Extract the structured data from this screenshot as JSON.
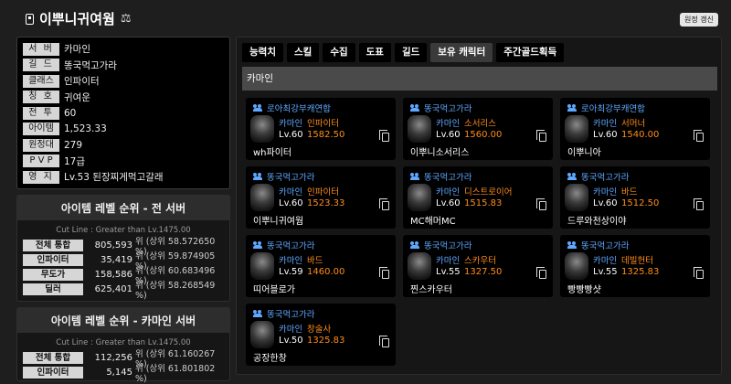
{
  "header": {
    "title": "이뿌니귀여웜",
    "refresh_label": "원정 갱신"
  },
  "profile": [
    {
      "label": "서 버",
      "value": "카마인"
    },
    {
      "label": "길 드",
      "value": "똥국먹고가라"
    },
    {
      "label": "클래스",
      "value": "인파이터"
    },
    {
      "label": "칭 호",
      "value": "귀여운"
    },
    {
      "label": "전 투",
      "value": "60"
    },
    {
      "label": "아이템",
      "value": "1,523.33"
    },
    {
      "label": "원정대",
      "value": "279"
    },
    {
      "label": "P V P",
      "value": "17급"
    },
    {
      "label": "영 지",
      "value": "Lv.53 된장찌게먹고갈래"
    }
  ],
  "rank_all": {
    "title": "아이템 레벨 순위 - 전 서버",
    "cutline": "Cut Line : Greater than Lv.1475.00",
    "rows": [
      {
        "label": "전체 통합",
        "rank": "805,593",
        "unit": "위 (상위 58.572650 %)"
      },
      {
        "label": "인파이터",
        "rank": "35,419",
        "unit": "위 (상위 59.874905 %)"
      },
      {
        "label": "무도가",
        "rank": "158,586",
        "unit": "위 (상위 60.683496 %)"
      },
      {
        "label": "딜러",
        "rank": "625,401",
        "unit": "위 (상위 58.268549 %)"
      }
    ]
  },
  "rank_server": {
    "title": "아이템 레벨 순위 - 카마인 서버",
    "cutline": "Cut Line : Greater than Lv.1475.00",
    "rows": [
      {
        "label": "전체 통합",
        "rank": "112,256",
        "unit": "위 (상위 61.160267 %)"
      },
      {
        "label": "인파이터",
        "rank": "5,145",
        "unit": "위 (상위 61.801802 %)"
      }
    ]
  },
  "tabs": [
    "능력치",
    "스킬",
    "수집",
    "도표",
    "길드",
    "보유 캐릭터",
    "주간골드획득"
  ],
  "active_tab": "보유 캐릭터",
  "server_name": "카마인",
  "characters": [
    {
      "guild": "로아최강부캐연합",
      "server": "카마인",
      "class": "인파이터",
      "level": "Lv.60",
      "item_level": "1582.50",
      "name": "wh파이터"
    },
    {
      "guild": "똥국먹고가라",
      "server": "카마인",
      "class": "소서리스",
      "level": "Lv.60",
      "item_level": "1560.00",
      "name": "이뿌니소서리스"
    },
    {
      "guild": "로아최강부캐연합",
      "server": "카마인",
      "class": "서머너",
      "level": "Lv.60",
      "item_level": "1540.00",
      "name": "이뿌니아"
    },
    {
      "guild": "똥국먹고가라",
      "server": "카마인",
      "class": "인파이터",
      "level": "Lv.60",
      "item_level": "1523.33",
      "name": "이뿌니귀여웜"
    },
    {
      "guild": "똥국먹고가라",
      "server": "카마인",
      "class": "디스트로이어",
      "level": "Lv.60",
      "item_level": "1515.83",
      "name": "MC해머MC"
    },
    {
      "guild": "똥국먹고가라",
      "server": "카마인",
      "class": "바드",
      "level": "Lv.60",
      "item_level": "1512.50",
      "name": "드루와천상이야"
    },
    {
      "guild": "똥국먹고가라",
      "server": "카마인",
      "class": "바드",
      "level": "Lv.59",
      "item_level": "1460.00",
      "name": "띠어블로가"
    },
    {
      "guild": "똥국먹고가라",
      "server": "카마인",
      "class": "스카우터",
      "level": "Lv.55",
      "item_level": "1327.50",
      "name": "찐스카우터"
    },
    {
      "guild": "똥국먹고가라",
      "server": "카마인",
      "class": "데빌헌터",
      "level": "Lv.55",
      "item_level": "1325.83",
      "name": "빵빵빵샷"
    },
    {
      "guild": "똥국먹고가라",
      "server": "카마인",
      "class": "창술사",
      "level": "Lv.50",
      "item_level": "1325.83",
      "name": "공장한창"
    }
  ],
  "colors": {
    "guild": "#5fa8ff",
    "item_level": "#ff8c1a",
    "background": "#1e1e1e"
  }
}
